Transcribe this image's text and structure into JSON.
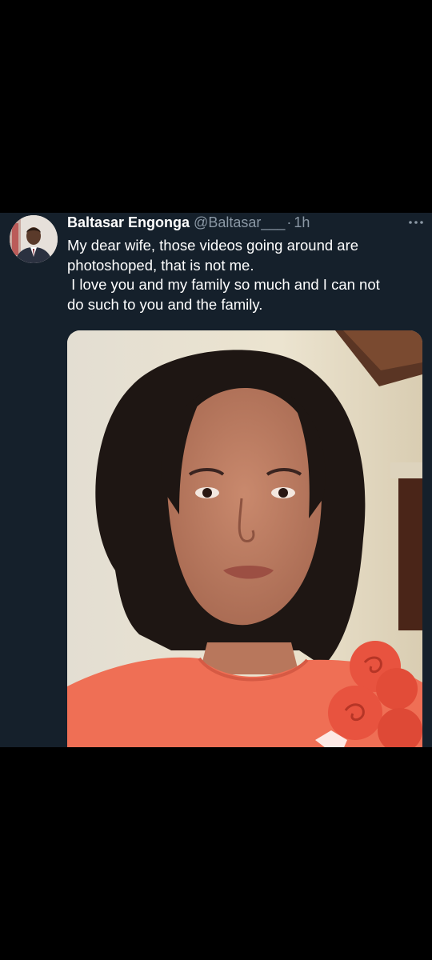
{
  "tweet": {
    "author_name": "Baltasar Engonga",
    "handle": "@Baltasar___",
    "separator": "·",
    "time": "1h",
    "text_lines": [
      "My dear wife, those videos going around are",
      "photoshoped, that is not me.",
      " I love you and my family so much and I can not",
      "do such to you and the family."
    ]
  },
  "icons": {
    "avatar": "profile-avatar-man-in-suit",
    "more": "more-horizontal-icon",
    "media": "photo-woman-portrait"
  },
  "colors": {
    "background": "#15202b",
    "text_primary": "#ffffff",
    "text_secondary": "#8b98a5",
    "page_outer": "#000000"
  }
}
